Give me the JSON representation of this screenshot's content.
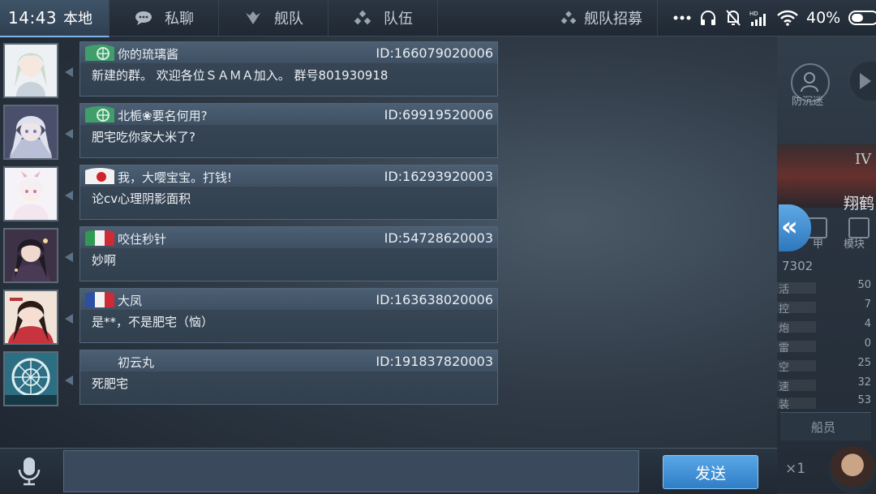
{
  "status_bar": {
    "time": "14:43",
    "battery_percent": "40%"
  },
  "tabs": [
    {
      "label": "本地",
      "icon": "globe-icon",
      "active": true
    },
    {
      "label": "私聊",
      "icon": "chat-bubble-icon",
      "active": false
    },
    {
      "label": "舰队",
      "icon": "fleet-emblem-icon",
      "active": false
    },
    {
      "label": "队伍",
      "icon": "team-dots-icon",
      "active": false
    }
  ],
  "recruit": {
    "label": "舰队招募",
    "icon": "team-dots-icon"
  },
  "messages": [
    {
      "sender": "你的琉璃酱",
      "id": "ID:166079020006",
      "text": "新建的群。 欢迎各位ＳＡＭＡ加入。 群号801930918",
      "flag": "green-emblem"
    },
    {
      "sender": "北栀❀要名何用?",
      "id": "ID:69919520006",
      "text": "肥宅吃你家大米了?",
      "flag": "green-emblem"
    },
    {
      "sender": "我，大嘤宝宝。打钱!",
      "id": "ID:16293920003",
      "text": "论cv心理阴影面积",
      "flag": "japan"
    },
    {
      "sender": "咬住秒针",
      "id": "ID:54728620003",
      "text": "妙啊",
      "flag": "italy"
    },
    {
      "sender": "大凤",
      "id": "ID:163638020006",
      "text": "是**，不是肥宅（恼）",
      "flag": "france"
    },
    {
      "sender": "初云丸",
      "id": "ID:191837820003",
      "text": "死肥宅",
      "flag": "none"
    }
  ],
  "input": {
    "placeholder": "",
    "value": ""
  },
  "send_label": "发送",
  "side_panel": {
    "button_label": "防沉迷",
    "roman": "IV",
    "ship_name": "翔鹤",
    "icon_labels": [
      "甲",
      "模块"
    ],
    "number": "7302",
    "stats": [
      {
        "label": "活",
        "value": "50"
      },
      {
        "label": "控",
        "value": "7"
      },
      {
        "label": "炮",
        "value": "4"
      },
      {
        "label": "雷",
        "value": "0"
      },
      {
        "label": "空",
        "value": "25"
      },
      {
        "label": "速",
        "value": "32"
      },
      {
        "label": "装",
        "value": "53"
      }
    ],
    "crew_label": "船员",
    "multiplier": "×1"
  },
  "colors": {
    "accent": "#4a9be0",
    "bubble": "#354454",
    "bubble_header": "#46586b"
  }
}
